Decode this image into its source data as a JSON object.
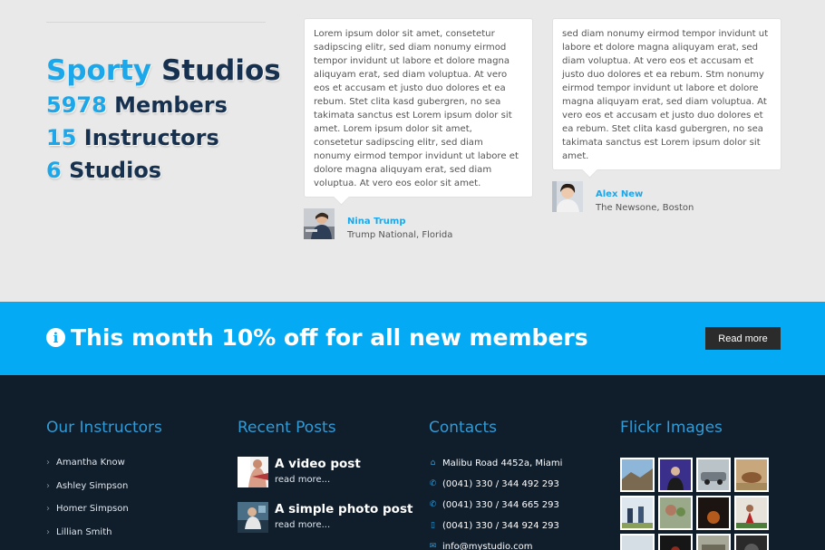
{
  "stats": {
    "title_hl": "Sporty",
    "title_rest": "Studios",
    "members_num": "5978",
    "members_label": "Members",
    "instructors_num": "15",
    "instructors_label": "Instructors",
    "studios_num": "6",
    "studios_label": "Studios"
  },
  "testimonials": [
    {
      "text": "Lorem ipsum dolor sit amet, consetetur sadipscing elitr, sed diam nonumy eirmod tempor invidunt ut labore et dolore magna aliquyam erat, sed diam voluptua. At vero eos et accusam et justo duo dolores et ea rebum. Stet clita kasd gubergren, no sea takimata sanctus est Lorem ipsum dolor sit amet. Lorem ipsum dolor sit amet, consetetur sadipscing elitr, sed diam nonumy eirmod tempor invidunt ut labore et dolore magna aliquyam erat, sed diam voluptua. At vero eos eolor sit amet.",
      "name": "Nina Trump",
      "location": "Trump National, Florida"
    },
    {
      "text": "sed diam nonumy eirmod tempor invidunt ut labore et dolore magna aliquyam erat, sed diam voluptua. At vero eos et accusam et justo duo dolores et ea rebum. Stm nonumy eirmod tempor invidunt ut labore et dolore magna aliquyam erat, sed diam voluptua. At vero eos et accusam et justo duo dolores et ea rebum. Stet clita kasd gubergren, no sea takimata sanctus est Lorem ipsum dolor sit amet.",
      "name": "Alex New",
      "location": "The Newsone, Boston"
    }
  ],
  "promo": {
    "icon": "info-icon",
    "text": "This month 10% off for all new members",
    "button": "Read more"
  },
  "footer": {
    "instructors_title": "Our Instructors",
    "instructors": [
      "Amantha Know",
      "Ashley Simpson",
      "Homer Simpson",
      "Lillian Smith"
    ],
    "posts_title": "Recent Posts",
    "posts": [
      {
        "title": "A video post",
        "more": "read more..."
      },
      {
        "title": "A simple photo post",
        "more": "read more..."
      }
    ],
    "contacts_title": "Contacts",
    "contacts": [
      {
        "icon": "home-icon",
        "text": "Malibu Road 4452a, Miami"
      },
      {
        "icon": "phone-icon",
        "text": "(0041) 330 / 344 492 293"
      },
      {
        "icon": "phone-icon",
        "text": "(0041) 330 / 344 665 293"
      },
      {
        "icon": "mobile-icon",
        "text": "(0041) 330 / 344 924 293"
      },
      {
        "icon": "envelope-icon",
        "text": "info@mystudio.com"
      }
    ],
    "flickr_title": "Flickr Images"
  },
  "colors": {
    "accent": "#1ba7ea",
    "promo_bg": "#04aaf4",
    "footer_bg": "#101d2b",
    "dark_text": "#16314f"
  }
}
